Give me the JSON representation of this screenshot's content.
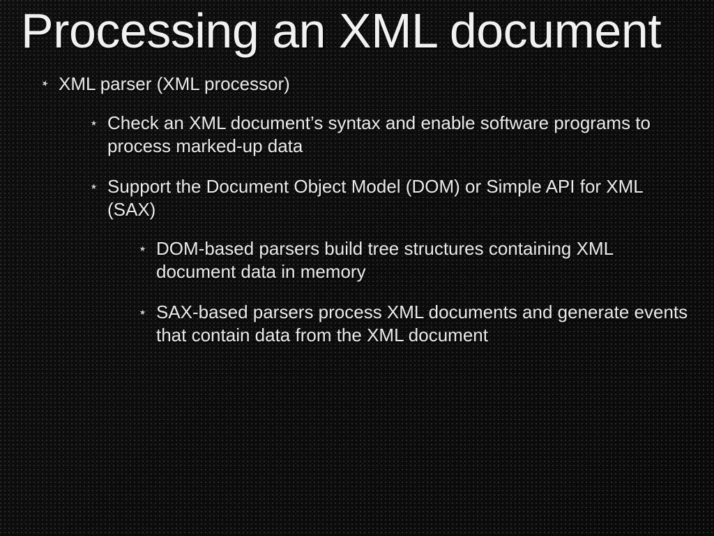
{
  "title": "Processing an XML document",
  "lvl1": [
    {
      "text": "XML parser (XML processor)",
      "lvl2": [
        {
          "text": "Check an XML document’s syntax and enable software programs to process marked-up data",
          "lvl3": []
        },
        {
          "text": "Support the Document Object Model (DOM) or Simple API for XML (SAX)",
          "lvl3": [
            {
              "text": "DOM-based parsers build tree structures containing XML document data in memory"
            },
            {
              "text": "SAX-based parsers process XML documents and generate events that contain data from the XML document"
            }
          ]
        }
      ]
    }
  ]
}
